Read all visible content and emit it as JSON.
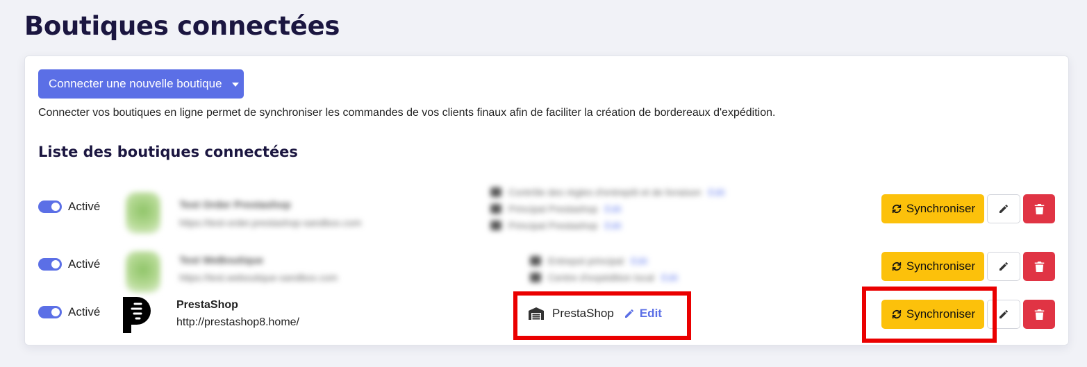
{
  "page": {
    "title": "Boutiques connectées"
  },
  "actions": {
    "connect_button_label": "Connecter une nouvelle boutique"
  },
  "intro_text": "Connecter vos boutiques en ligne permet de synchroniser les commandes de vos clients finaux afin de faciliter la création de bordereaux d'expédition.",
  "list": {
    "title": "Liste des boutiques connectées",
    "rows": [
      {
        "toggle_label": "Activé",
        "name": "Test Order Prestashop",
        "url": "https://test-order.prestashop-sandbox.com",
        "details": [
          {
            "text": "Contrôle des règles d'entrepôt et de livraison",
            "link": "Edit"
          },
          {
            "text": "Principal Prestashop",
            "link": "Edit"
          },
          {
            "text": "Principal Prestashop",
            "link": "Edit"
          }
        ],
        "sync_label": "Synchroniser"
      },
      {
        "toggle_label": "Activé",
        "name": "Test WeBoutique",
        "url": "https://test.weboutique-sandbox.com",
        "details": [
          {
            "text": "Entrepot principal",
            "link": "Edit"
          },
          {
            "text": "Centre d'expédition local",
            "link": "Edit"
          }
        ],
        "sync_label": "Synchroniser"
      },
      {
        "toggle_label": "Activé",
        "name": "PrestaShop",
        "url": "http://prestashop8.home/",
        "platform": "PrestaShop",
        "edit_label": "Edit",
        "sync_label": "Synchroniser"
      }
    ]
  },
  "colors": {
    "primary": "#5b6fe6",
    "warning": "#fcc10b",
    "danger": "#e03444",
    "highlight": "#ea0000",
    "title": "#1b1640"
  },
  "icons": {
    "sync": "sync-icon",
    "edit": "pencil-icon",
    "delete": "trash-icon",
    "warehouse": "warehouse-icon",
    "dropdown": "chevron-down-icon"
  }
}
